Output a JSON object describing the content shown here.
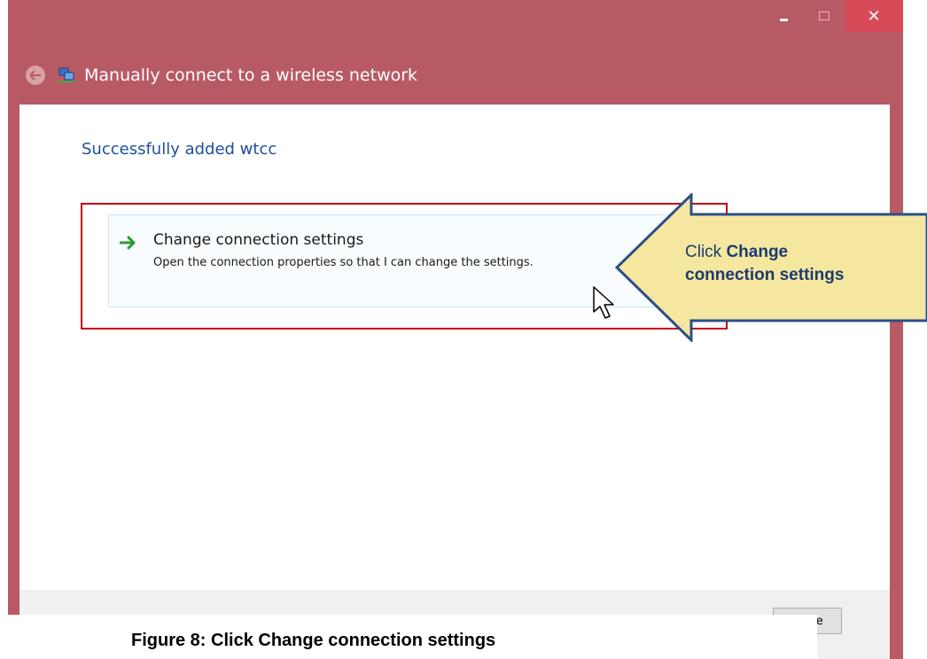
{
  "window": {
    "title": "Manually connect to a wireless network",
    "controls": {
      "minimize": "minimize-icon",
      "maximize": "maximize-icon",
      "close": "✕"
    }
  },
  "main": {
    "success_message": "Successfully added wtcc",
    "option": {
      "title": "Change connection settings",
      "description": "Open the connection properties so that I can change the settings."
    }
  },
  "footer": {
    "close_label": "Close"
  },
  "callout": {
    "prefix": "Click",
    "bold_line1": "Change",
    "bold_line2": "connection settings"
  },
  "caption": "Figure 8: Click Change connection settings",
  "colors": {
    "titlebar": "#b85a64",
    "close_button": "#d74b58",
    "accent_text": "#1f4e9c",
    "highlight": "#c00010",
    "callout_fill": "#f5e7a0",
    "callout_border": "#2c4f86"
  }
}
